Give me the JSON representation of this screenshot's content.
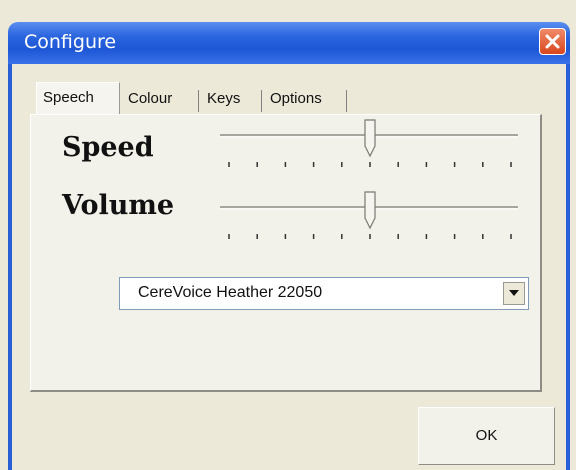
{
  "window": {
    "title": "Configure",
    "close_icon": "close-icon"
  },
  "tabs": [
    {
      "label": "Speech",
      "active": true
    },
    {
      "label": "Colour",
      "active": false
    },
    {
      "label": "Keys",
      "active": false
    },
    {
      "label": "Options",
      "active": false
    }
  ],
  "speech": {
    "speed": {
      "label": "Speed",
      "value_fraction": 0.5
    },
    "volume": {
      "label": "Volume",
      "value_fraction": 0.5
    },
    "voice": {
      "selected": "CereVoice Heather 22050"
    }
  },
  "buttons": {
    "ok": "OK"
  },
  "colors": {
    "titlebar": "#1e57d6",
    "close": "#d9461d",
    "window": "#ece9d8"
  }
}
